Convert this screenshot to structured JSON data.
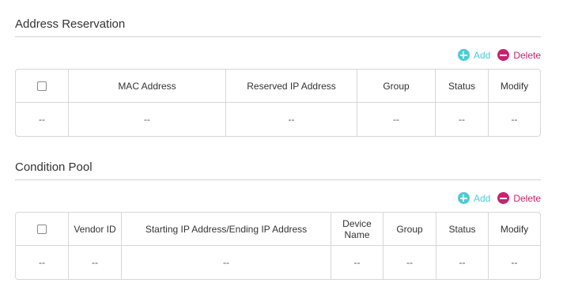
{
  "reservation": {
    "title": "Address Reservation",
    "add_label": "Add",
    "delete_label": "Delete",
    "columns": [
      "MAC Address",
      "Reserved IP Address",
      "Group",
      "Status",
      "Modify"
    ],
    "row": [
      "--",
      "--",
      "--",
      "--",
      "--",
      "--"
    ]
  },
  "pool": {
    "title": "Condition Pool",
    "add_label": "Add",
    "delete_label": "Delete",
    "columns": [
      "Vendor ID",
      "Starting IP Address/Ending IP Address",
      "Device\nName",
      "Group",
      "Status",
      "Modify"
    ],
    "row": [
      "--",
      "--",
      "--",
      "--",
      "--",
      "--",
      "--"
    ]
  },
  "colors": {
    "add": "#4acbd6",
    "delete": "#c5246e",
    "border": "#d7d7d7"
  }
}
